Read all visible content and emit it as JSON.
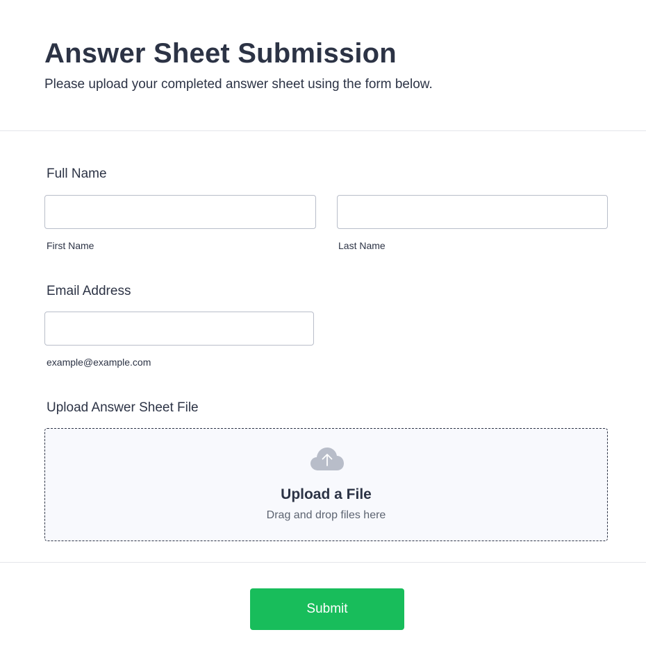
{
  "header": {
    "title": "Answer Sheet Submission",
    "subtitle": "Please upload your completed answer sheet using the form below."
  },
  "full_name": {
    "label": "Full Name",
    "first": {
      "value": "",
      "sublabel": "First Name"
    },
    "last": {
      "value": "",
      "sublabel": "Last Name"
    }
  },
  "email": {
    "label": "Email Address",
    "value": "",
    "sublabel": "example@example.com"
  },
  "upload": {
    "label": "Upload Answer Sheet File",
    "icon": "cloud-upload-icon",
    "title": "Upload a File",
    "hint": "Drag and drop files here"
  },
  "submit": {
    "label": "Submit"
  },
  "colors": {
    "text": "#2c3345",
    "border": "#b8bdc9",
    "upload_bg": "#f8f9fd",
    "icon": "#b8bdc9",
    "submit_bg": "#18bd5b",
    "divider": "#e3e5ea"
  }
}
